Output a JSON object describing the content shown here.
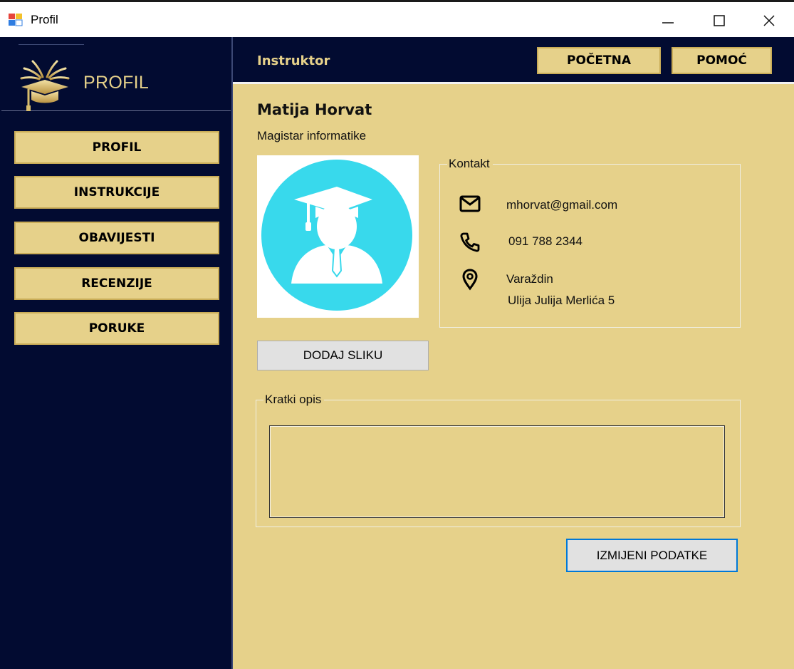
{
  "window": {
    "title": "Profil",
    "app_icon": "windows-forms-app-icon",
    "controls": {
      "minimize": "minimize-icon",
      "maximize": "maximize-icon",
      "close": "close-icon"
    }
  },
  "sidebar": {
    "logo": {
      "icon": "graduation-cap-logo-icon",
      "text": "PROFIL"
    },
    "items": [
      {
        "label": "PROFIL"
      },
      {
        "label": "INSTRUKCIJE"
      },
      {
        "label": "OBAVIJESTI"
      },
      {
        "label": "RECENZIJE"
      },
      {
        "label": "PORUKE"
      }
    ]
  },
  "header": {
    "title": "Instruktor",
    "buttons": {
      "home": "POČETNA",
      "help": "POMOĆ"
    }
  },
  "profile": {
    "name": "Matija Horvat",
    "title": "Magistar informatike",
    "avatar_icon": "graduate-avatar-icon",
    "add_photo_label": "DODAJ SLIKU",
    "contact": {
      "legend": "Kontakt",
      "email": "mhorvat@gmail.com",
      "phone": "091 788 2344",
      "city": "Varaždin",
      "street": "Ulija Julija Merlića 5"
    },
    "description": {
      "legend": "Kratki opis",
      "value": ""
    },
    "edit_label": "IZMIJENI PODATKE"
  },
  "colors": {
    "navy": "#020b31",
    "gold": "#e6d18a",
    "gold_border": "#c9ac57",
    "avatar_cyan": "#38d9ec",
    "focus_blue": "#0078d7"
  }
}
